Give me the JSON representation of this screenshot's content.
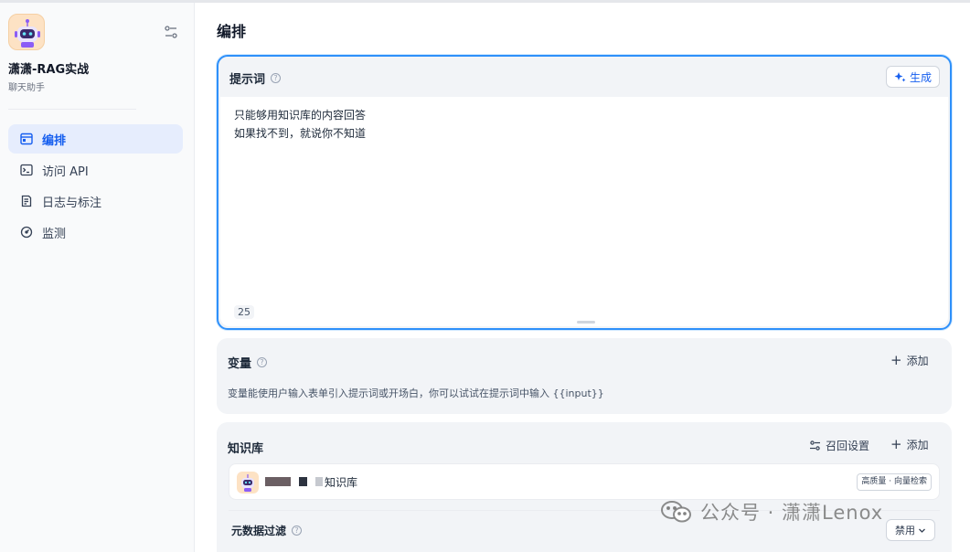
{
  "sidebar": {
    "app_name": "潇潇-RAG实战",
    "app_type": "聊天助手",
    "items": [
      {
        "label": "编排",
        "icon": "layout-icon",
        "active": true
      },
      {
        "label": "访问 API",
        "icon": "terminal-icon",
        "active": false
      },
      {
        "label": "日志与标注",
        "icon": "document-icon",
        "active": false
      },
      {
        "label": "监测",
        "icon": "gauge-icon",
        "active": false
      }
    ]
  },
  "main": {
    "title": "编排",
    "prompt": {
      "title": "提示词",
      "generate_label": "生成",
      "text": "只能够用知识库的内容回答\n如果找不到，就说你不知道",
      "char_count": "25"
    },
    "variables": {
      "title": "变量",
      "add_label": "添加",
      "description": "变量能使用户输入表单引入提示词或开场白，你可以试试在提示词中输入 {{input}}"
    },
    "knowledge": {
      "title": "知识库",
      "recall_label": "召回设置",
      "add_label": "添加",
      "item_name": "知识库",
      "item_tag": "高质量 · 向量检索",
      "metadata_filter_label": "元数据过滤",
      "metadata_filter_value": "禁用"
    }
  },
  "watermark": "公众号 · 潇潇Lenox",
  "colors": {
    "accent": "#155eef",
    "active_bg": "#e6edfd",
    "card_bg": "#f2f4f7",
    "focus_border": "#2e90fa"
  }
}
